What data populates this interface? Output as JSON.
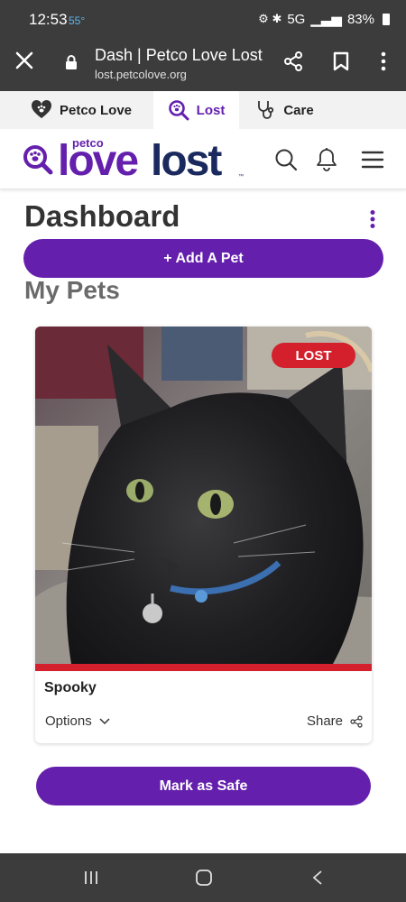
{
  "status_bar": {
    "time": "12:53",
    "temperature": "55°",
    "network": "5G",
    "battery": "83%"
  },
  "browser": {
    "tab_title": "Dash | Petco Love Lost",
    "url": "lost.petcolove.org"
  },
  "site_nav": {
    "items": [
      {
        "label": "Petco Love",
        "icon": "heart-paw-icon",
        "active": false
      },
      {
        "label": "Lost",
        "icon": "search-paw-icon",
        "active": true
      },
      {
        "label": "Care",
        "icon": "stethoscope-icon",
        "active": false
      }
    ]
  },
  "brand": {
    "logo_small": "petco",
    "logo_love": "love",
    "logo_lost": "lost",
    "logo_tm": "™"
  },
  "dashboard": {
    "title": "Dashboard",
    "add_pet_label": "+ Add A Pet",
    "my_pets_title": "My Pets"
  },
  "pet": {
    "name": "Spooky",
    "status_badge": "LOST",
    "options_label": "Options",
    "share_label": "Share"
  },
  "mark_safe_label": "Mark as Safe",
  "colors": {
    "brand_purple": "#6420ad",
    "lost_red": "#d4202d",
    "brand_navy": "#1b2a5e"
  }
}
